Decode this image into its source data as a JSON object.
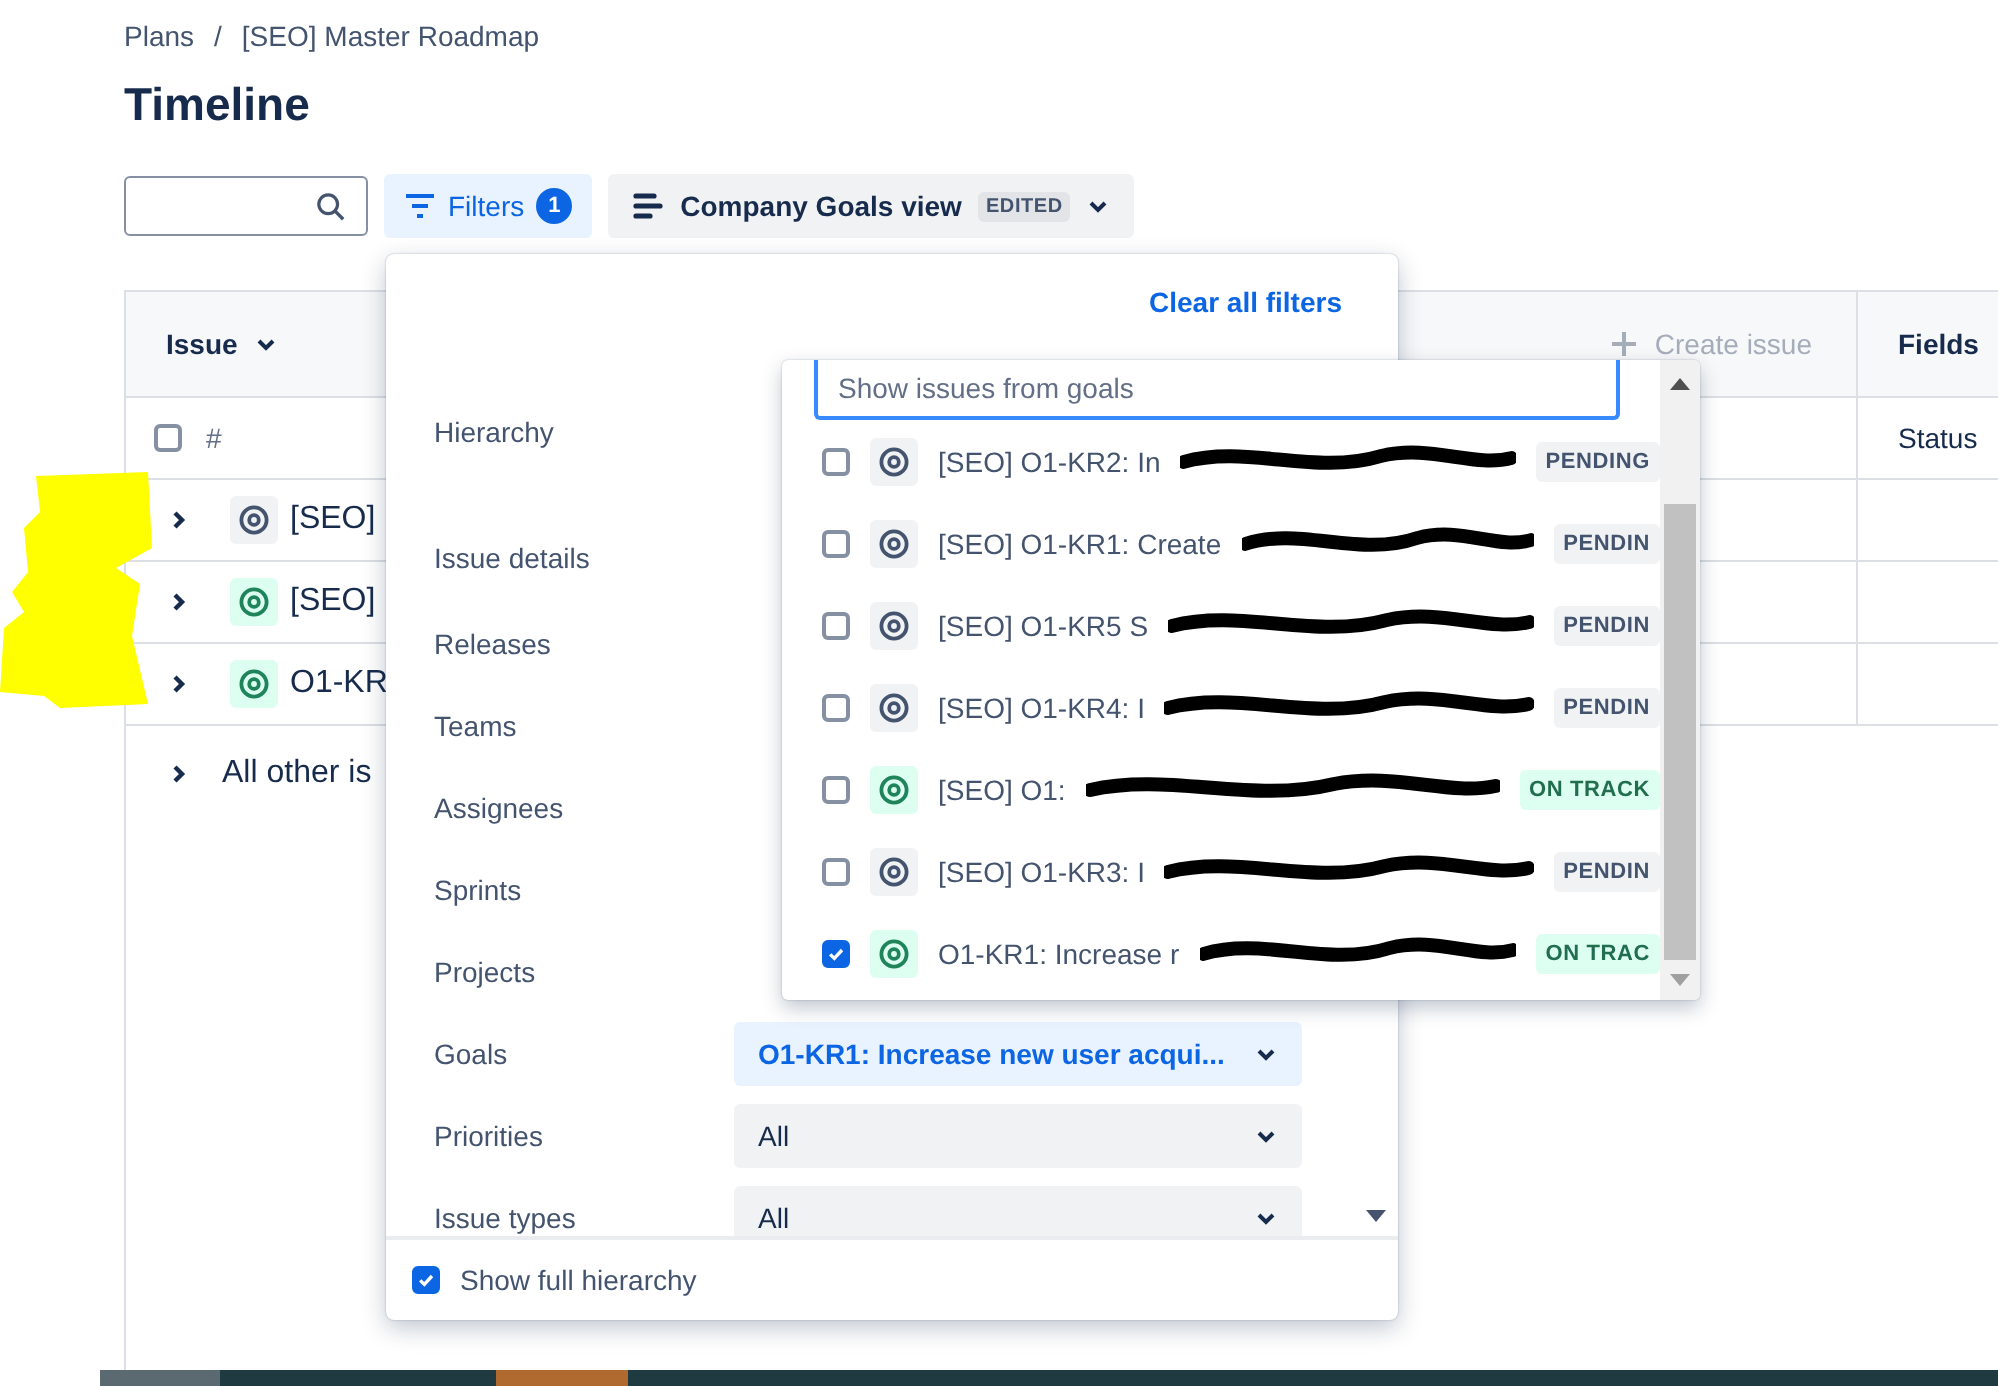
{
  "breadcrumbs": [
    "Plans",
    "[SEO] Master Roadmap"
  ],
  "breadcrumb_separator": "/",
  "title": "Timeline",
  "toolbar": {
    "filters_label": "Filters",
    "filters_count": "1",
    "view_label": "Company Goals view",
    "view_badge": "EDITED"
  },
  "table": {
    "issue_header": "Issue",
    "create_label": "Create issue",
    "fields_header": "Fields",
    "hash_label": "#",
    "select_all_checked": false,
    "status_label": "Status",
    "rows": [
      {
        "text": "[SEO]",
        "kind": "pending"
      },
      {
        "text": "[SEO]",
        "kind": "on_track"
      },
      {
        "text": "O1-KR",
        "kind": "on_track"
      }
    ],
    "other_row": "All other is"
  },
  "filters": {
    "clear_label": "Clear all filters",
    "rows": [
      {
        "label": "Hierarchy"
      },
      {
        "label": "Issue details"
      },
      {
        "label": "Releases"
      },
      {
        "label": "Teams"
      },
      {
        "label": "Assignees"
      },
      {
        "label": "Sprints"
      },
      {
        "label": "Projects"
      },
      {
        "label": "Goals",
        "value": "O1-KR1: Increase new user acqui...",
        "active": true
      },
      {
        "label": "Priorities",
        "value": "All",
        "active": false
      },
      {
        "label": "Issue types",
        "value": "All",
        "active": false
      }
    ],
    "show_full_hierarchy": {
      "label": "Show full hierarchy",
      "checked": true
    }
  },
  "goal_list": {
    "search_value": "Show issues from goals",
    "items": [
      {
        "label": "[SEO] O1-KR2: In",
        "status": "PENDING",
        "kind": "pending",
        "checked": false
      },
      {
        "label": "[SEO] O1-KR1: Create",
        "status": "PENDIN",
        "kind": "pending",
        "checked": false
      },
      {
        "label": "[SEO] O1-KR5 S",
        "status": "PENDIN",
        "kind": "pending",
        "checked": false
      },
      {
        "label": "[SEO] O1-KR4: I",
        "status": "PENDIN",
        "kind": "pending",
        "checked": false
      },
      {
        "label": "[SEO] O1:",
        "status": "ON TRACK",
        "kind": "on_track",
        "checked": false
      },
      {
        "label": "[SEO] O1-KR3: I",
        "status": "PENDIN",
        "kind": "pending",
        "checked": false
      },
      {
        "label": "O1-KR1: Increase r",
        "status": "ON TRAC",
        "kind": "on_track",
        "checked": true
      }
    ]
  }
}
